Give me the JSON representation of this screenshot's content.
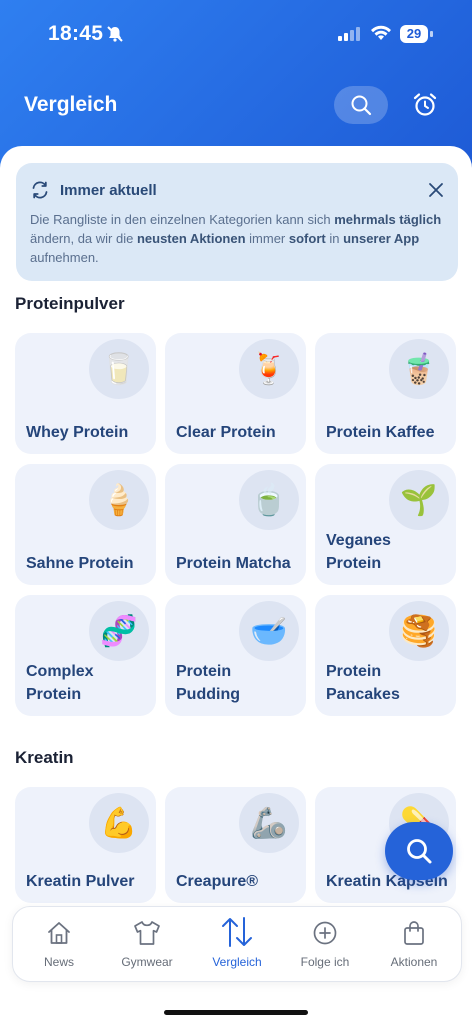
{
  "status": {
    "time": "18:45",
    "battery": "29"
  },
  "header": {
    "title": "Vergleich"
  },
  "info": {
    "title": "Immer aktuell",
    "text_parts": [
      {
        "t": "Die Rangliste in den einzelnen Kategorien kann sich ",
        "b": false
      },
      {
        "t": "mehrmals täglich",
        "b": true
      },
      {
        "t": " ändern, da wir die ",
        "b": false
      },
      {
        "t": "neusten Aktionen",
        "b": true
      },
      {
        "t": " immer ",
        "b": false
      },
      {
        "t": "sofort",
        "b": true
      },
      {
        "t": " in ",
        "b": false
      },
      {
        "t": "unserer App",
        "b": true
      },
      {
        "t": " aufnehmen.",
        "b": false
      }
    ]
  },
  "sections": {
    "protein": {
      "title": "Proteinpulver",
      "tiles": [
        {
          "label": "Whey Protein",
          "icon": "🥛",
          "name": "milk-glass-icon"
        },
        {
          "label": "Clear Protein",
          "icon": "🍹",
          "name": "tropical-drink-icon"
        },
        {
          "label": "Protein Kaffee",
          "icon": "🧋",
          "name": "bubble-tea-icon"
        },
        {
          "label": "Sahne Protein",
          "icon": "🍦",
          "name": "soft-ice-cream-icon"
        },
        {
          "label": "Protein Matcha",
          "icon": "🍵",
          "name": "matcha-tea-icon"
        },
        {
          "label": "Veganes Protein",
          "icon": "🌱",
          "name": "seedling-icon"
        },
        {
          "label": "Complex Protein",
          "icon": "🧬",
          "name": "dna-icon"
        },
        {
          "label": "Protein Pudding",
          "icon": "🥣",
          "name": "bowl-with-spoon-icon"
        },
        {
          "label": "Protein Pancakes",
          "icon": "🥞",
          "name": "pancakes-icon"
        }
      ]
    },
    "kreatin": {
      "title": "Kreatin",
      "tiles": [
        {
          "label": "Kreatin Pulver",
          "icon": "💪",
          "name": "flexed-biceps-icon"
        },
        {
          "label": "Creapure®",
          "icon": "🦾",
          "name": "mechanical-arm-icon"
        },
        {
          "label": "Kreatin Kapseln",
          "icon": "💊",
          "name": "pill-icon"
        }
      ]
    }
  },
  "nav": [
    {
      "label": "News",
      "icon": "home-icon",
      "active": false
    },
    {
      "label": "Gymwear",
      "icon": "tshirt-icon",
      "active": false
    },
    {
      "label": "Vergleich",
      "icon": "compare-arrows-icon",
      "active": true
    },
    {
      "label": "Folge ich",
      "icon": "plus-circle-icon",
      "active": false
    },
    {
      "label": "Aktionen",
      "icon": "shopping-bag-icon",
      "active": false
    }
  ],
  "colors": {
    "accent": "#2563d9",
    "header": "#2f7ff0",
    "tile_bg": "#eef2fb",
    "info_bg": "#dbe8f6"
  }
}
